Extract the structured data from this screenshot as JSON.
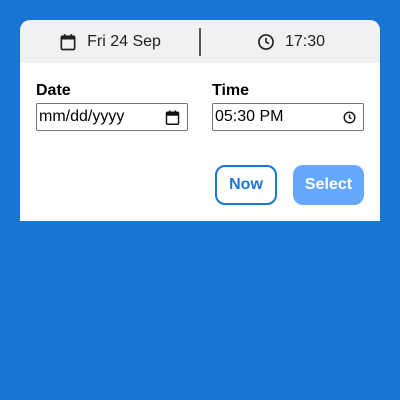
{
  "header": {
    "date_text": "Fri 24 Sep",
    "time_text": "17:30",
    "date_icon": "calendar-icon",
    "time_icon": "clock-icon"
  },
  "form": {
    "date_label": "Date",
    "date_value": "mm/dd/yyyy",
    "time_label": "Time",
    "time_value": "05:30 PM"
  },
  "buttons": {
    "now_label": "Now",
    "select_label": "Select"
  },
  "colors": {
    "background": "#1976d2",
    "accent": "#1976d2",
    "select_button": "#64a8ff"
  }
}
